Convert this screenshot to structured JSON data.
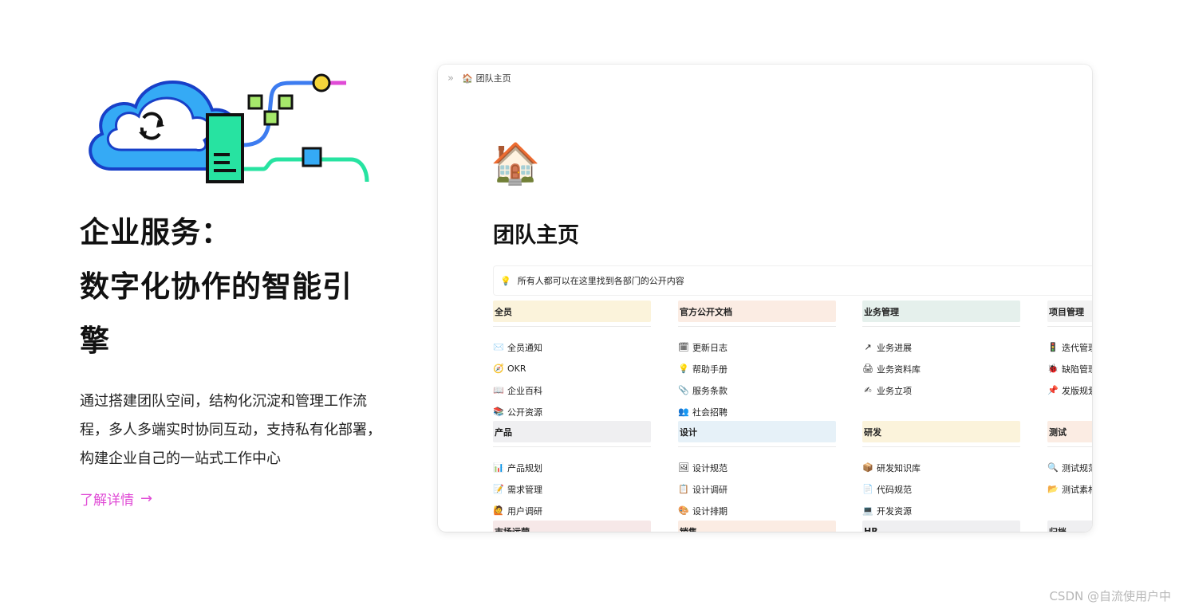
{
  "hero": {
    "title_line1": "企业服务：",
    "title_line2": "数字化协作的智能引",
    "title_line3": "擎",
    "description": "通过搭建团队空间，结构化沉淀和管理工作流程，多人多端实时协同互动，支持私有化部署，构建企业自己的一站式工作中心",
    "learn_more": "了解详情",
    "learn_more_arrow": "→"
  },
  "colors": {
    "accent": "#e04bd6",
    "cloud": "#35aaf5",
    "server": "#27e3a1"
  },
  "screenshot": {
    "breadcrumb": "团队主页",
    "breadcrumb_icon": "🏠",
    "page_emoji": "🏠",
    "page_title": "团队主页",
    "callout_icon": "💡",
    "callout_text": "所有人都可以在这里找到各部门的公开内容",
    "sections": [
      {
        "title": "全员",
        "bg": "#fbf3db",
        "items": [
          {
            "icon": "✉️",
            "label": "全员通知"
          },
          {
            "icon": "🧭",
            "label": "OKR"
          },
          {
            "icon": "📖",
            "label": "企业百科"
          },
          {
            "icon": "📚",
            "label": "公开资源"
          }
        ]
      },
      {
        "title": "官方公开文档",
        "bg": "#fbece3",
        "items": [
          {
            "icon": "🗓",
            "label": "更新日志"
          },
          {
            "icon": "💡",
            "label": "帮助手册"
          },
          {
            "icon": "📎",
            "label": "服务条款"
          },
          {
            "icon": "👥",
            "label": "社会招聘"
          }
        ]
      },
      {
        "title": "业务管理",
        "bg": "#e5f0ec",
        "items": [
          {
            "icon": "↗",
            "label": "业务进展"
          },
          {
            "icon": "🖨",
            "label": "业务资料库"
          },
          {
            "icon": "✍",
            "label": "业务立项"
          }
        ]
      },
      {
        "title": "项目管理",
        "bg": "#f3f3f3",
        "items": [
          {
            "icon": "🚦",
            "label": "迭代管理"
          },
          {
            "icon": "🐞",
            "label": "缺陷管理"
          },
          {
            "icon": "📌",
            "label": "发版规划"
          }
        ]
      },
      {
        "title": "产品",
        "bg": "#efeff1",
        "items": [
          {
            "icon": "📊",
            "label": "产品规划"
          },
          {
            "icon": "📝",
            "label": "需求管理"
          },
          {
            "icon": "🙋",
            "label": "用户调研"
          }
        ]
      },
      {
        "title": "设计",
        "bg": "#e6f1f8",
        "items": [
          {
            "icon": "🖼",
            "label": "设计规范"
          },
          {
            "icon": "📋",
            "label": "设计调研"
          },
          {
            "icon": "🎨",
            "label": "设计排期"
          }
        ]
      },
      {
        "title": "研发",
        "bg": "#fbf3db",
        "items": [
          {
            "icon": "📦",
            "label": "研发知识库"
          },
          {
            "icon": "📄",
            "label": "代码规范"
          },
          {
            "icon": "💻",
            "label": "开发资源"
          }
        ]
      },
      {
        "title": "测试",
        "bg": "#fbece3",
        "items": [
          {
            "icon": "🔍",
            "label": "测试规范"
          },
          {
            "icon": "📂",
            "label": "测试素材"
          }
        ]
      },
      {
        "title": "市场运营",
        "bg": "#f6e8e8",
        "items": []
      },
      {
        "title": "销售",
        "bg": "#fbece3",
        "items": []
      },
      {
        "title": "HR",
        "bg": "#efeff1",
        "items": []
      },
      {
        "title": "归档",
        "bg": "#efeff1",
        "items": []
      }
    ]
  },
  "watermark": "CSDN @自流使用户中"
}
